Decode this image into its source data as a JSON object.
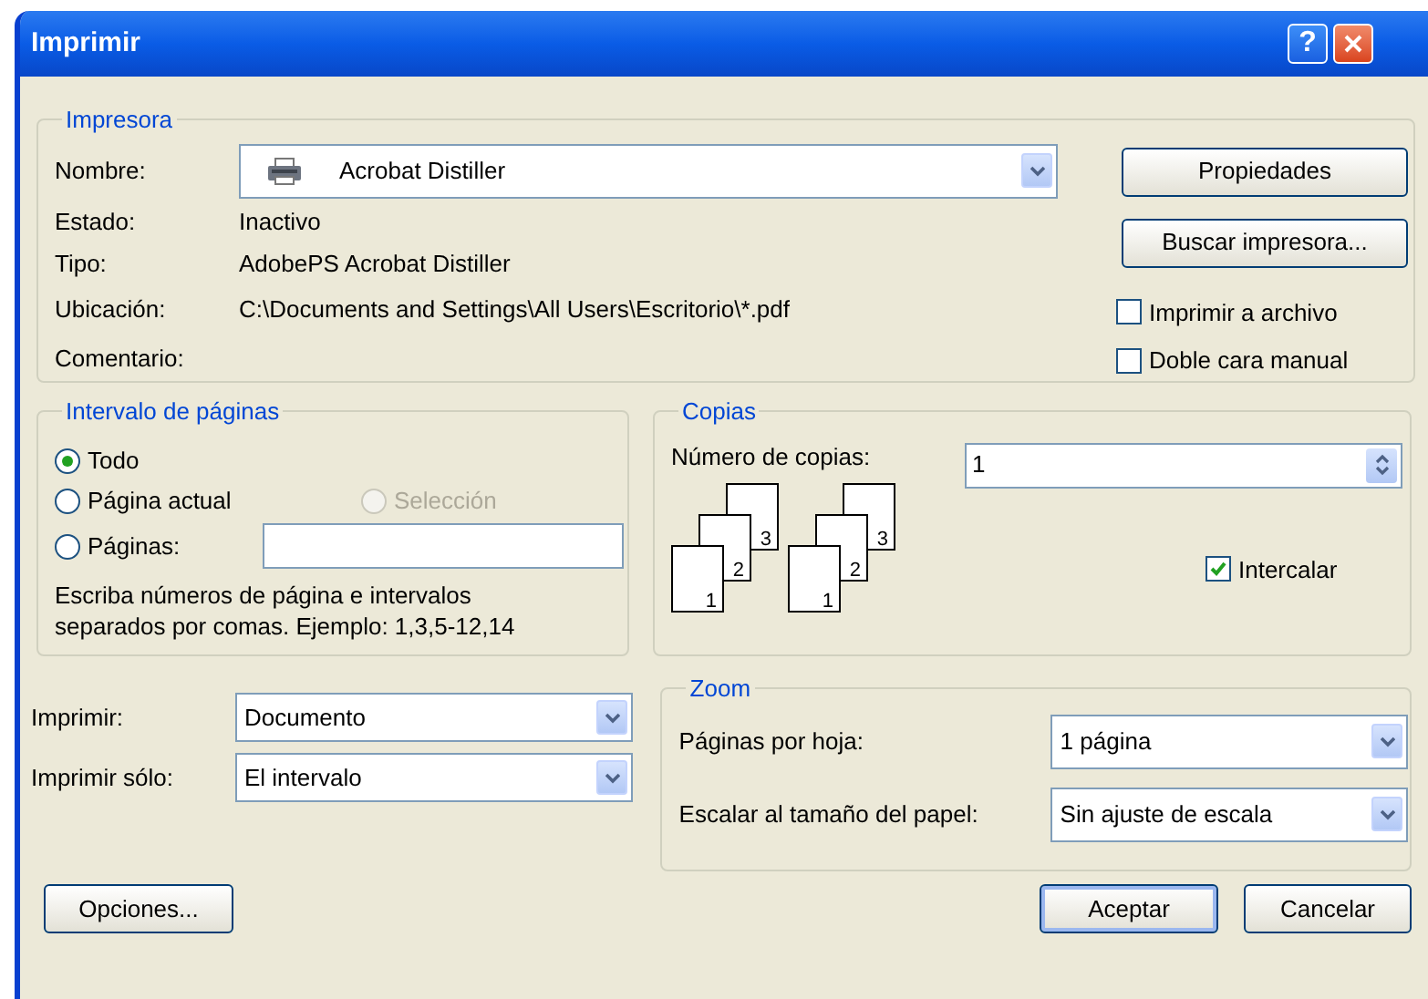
{
  "window": {
    "title": "Imprimir",
    "help": "?"
  },
  "printer": {
    "legend": "Impresora",
    "fields": [
      {
        "kind": "combo",
        "label": "Nombre:",
        "value": "Acrobat Distiller"
      },
      {
        "kind": "text",
        "label": "Estado:",
        "value": "Inactivo"
      },
      {
        "kind": "text",
        "label": "Tipo:",
        "value": "AdobePS Acrobat Distiller"
      },
      {
        "kind": "text",
        "label": "Ubicación:",
        "value": "C:\\Documents and Settings\\All Users\\Escritorio\\*.pdf"
      },
      {
        "kind": "text",
        "label": "Comentario:"
      }
    ],
    "buttons": [
      "Propiedades",
      "Buscar impresora..."
    ],
    "options": [
      {
        "label": "Imprimir a archivo",
        "checked": false
      },
      {
        "label": "Doble cara manual",
        "checked": false
      }
    ]
  },
  "page_range": {
    "legend": "Intervalo de páginas",
    "options": [
      {
        "label": "Todo",
        "selected": true,
        "disabled": false
      },
      {
        "label": "Página actual",
        "selected": false,
        "disabled": false
      },
      {
        "label": "Selección",
        "selected": false,
        "disabled": true
      },
      {
        "label": "Páginas:",
        "selected": false,
        "disabled": false
      }
    ],
    "hint": "Escriba números de página e intervalos separados por comas. Ejemplo: 1,3,5-12,14"
  },
  "copies": {
    "legend": "Copias",
    "label": "Número de copias:",
    "value": "1",
    "stacks": [
      {
        "pages": [
          "1",
          "2",
          "3"
        ]
      },
      {
        "pages": [
          "1",
          "2",
          "3"
        ]
      }
    ],
    "collate": {
      "label": "Intercalar",
      "checked": true
    }
  },
  "print_what": [
    {
      "label": "Imprimir:",
      "value": "Documento"
    },
    {
      "label": "Imprimir sólo:",
      "value": "El intervalo"
    }
  ],
  "zoom": {
    "legend": "Zoom",
    "fields": [
      {
        "label": "Páginas por hoja:",
        "value": "1 página"
      },
      {
        "label": "Escalar al tamaño del papel:",
        "value": "Sin ajuste de escala"
      }
    ]
  },
  "buttons": [
    {
      "label": "Opciones...",
      "default": false
    },
    {
      "label": "Aceptar",
      "default": true
    },
    {
      "label": "Cancelar",
      "default": false
    }
  ]
}
